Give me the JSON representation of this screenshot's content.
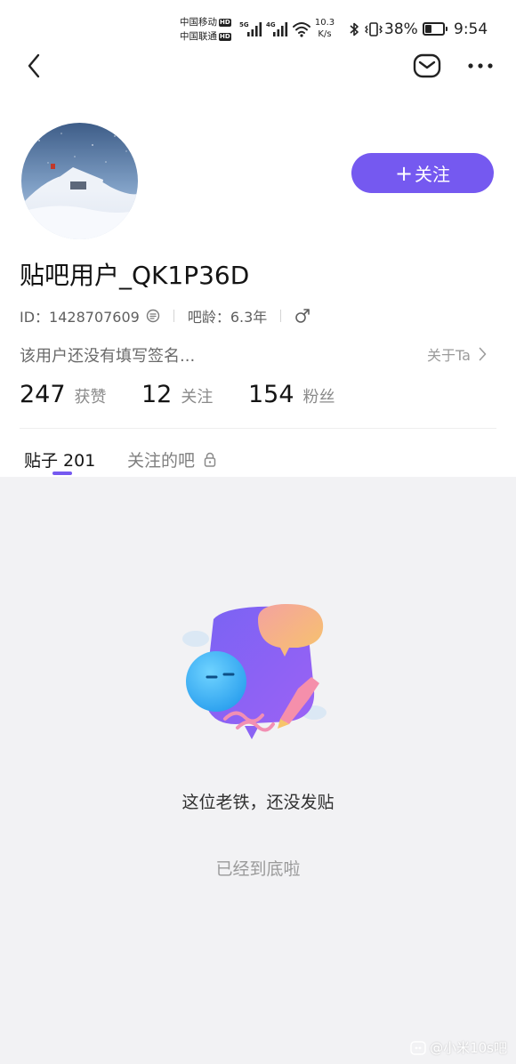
{
  "status_bar": {
    "carrier_1": "中国移动",
    "carrier_2": "中国联通",
    "hd_badge": "HD",
    "net_1": "5G",
    "net_2": "4G",
    "speed_value": "10.3",
    "speed_unit": "K/s",
    "battery_percent": "38%",
    "battery_level": 0.38,
    "time": "9:54"
  },
  "nav": {
    "back_icon": "chevron-left",
    "mail_icon": "envelope",
    "more_icon": "ellipsis"
  },
  "profile": {
    "username": "贴吧用户_QK1P36D",
    "id_text": "ID：1428707609",
    "age_text": "吧龄：6.3年",
    "gender_icon": "male-symbol",
    "signature": "该用户还没有填写签名...",
    "about_label": "关于Ta",
    "follow_button_label": "关注",
    "follow_plus": "+"
  },
  "stats": [
    {
      "value": "247",
      "label": "获赞"
    },
    {
      "value": "12",
      "label": "关注"
    },
    {
      "value": "154",
      "label": "粉丝"
    }
  ],
  "tabs": {
    "posts_label": "贴子 201",
    "followed_bars_label": "关注的吧"
  },
  "empty_state": {
    "title": "这位老铁，还没发贴",
    "subtitle": "已经到底啦"
  },
  "watermark": {
    "text": "@小米10s吧"
  },
  "colors": {
    "accent": "#7559f0",
    "content_bg": "#f2f2f4"
  }
}
